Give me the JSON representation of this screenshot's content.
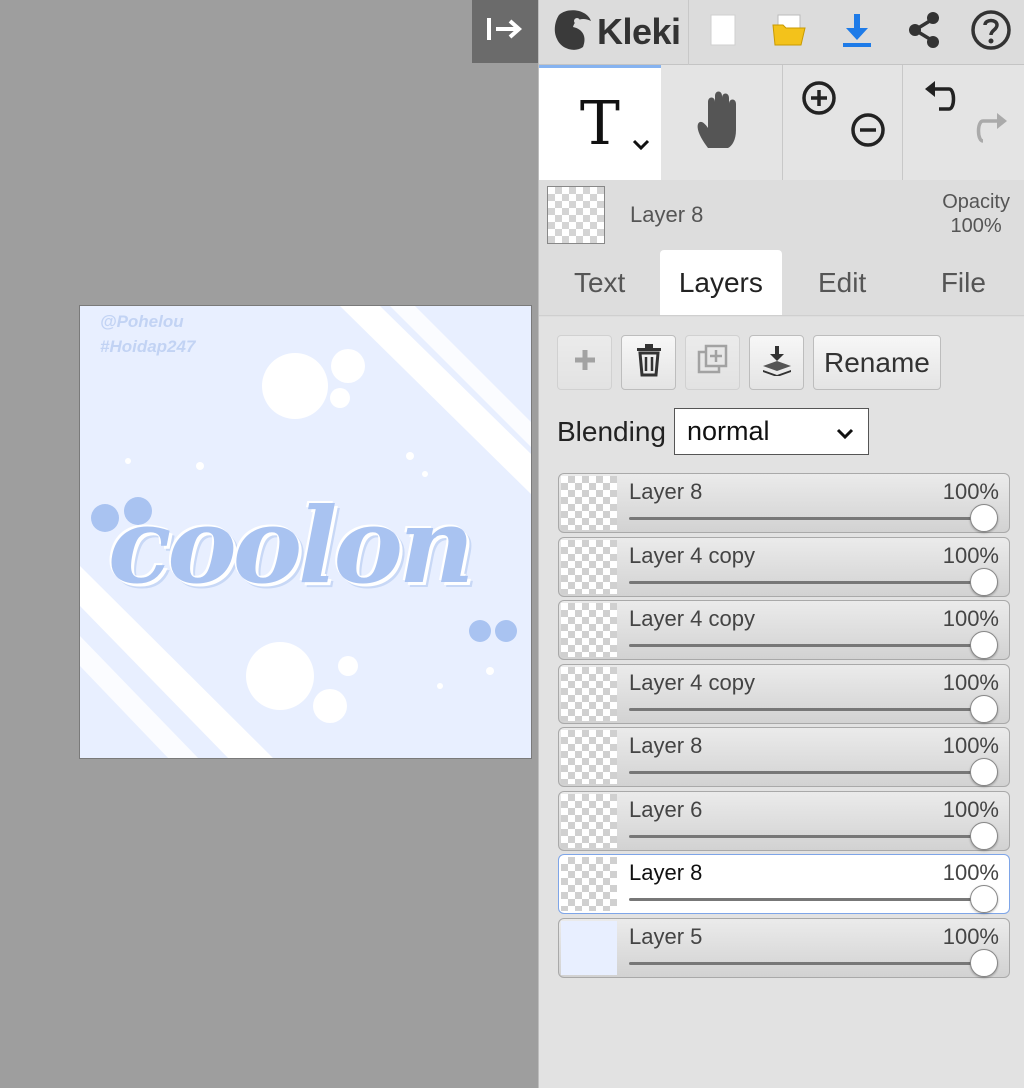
{
  "app": {
    "name": "Kleki"
  },
  "icons": {
    "collapse": "collapse-panel-icon",
    "logo": "kleki-logo-icon",
    "new": "new-file-icon",
    "open": "open-folder-icon",
    "save": "download-icon",
    "share": "share-icon",
    "help": "help-icon",
    "text_tool": "text-tool-icon",
    "hand_tool": "hand-tool-icon",
    "zoom_in": "zoom-in-icon",
    "zoom_out": "zoom-out-icon",
    "undo": "undo-icon",
    "redo": "redo-icon",
    "add_layer": "add-layer-icon",
    "delete_layer": "trash-icon",
    "duplicate_layer": "duplicate-layer-icon",
    "merge_layer": "merge-down-icon"
  },
  "colors": {
    "accent": "#86b3f0",
    "download": "#1e7be8",
    "folder": "#f3c21b",
    "art_bg": "#e8efff",
    "art_text": "#a9c3f1"
  },
  "toolbar": {
    "text_tool_glyph": "T"
  },
  "current_layer": {
    "name": "Layer 8",
    "opacity_label": "Opacity",
    "opacity_value": "100%"
  },
  "tabs": [
    {
      "label": "Text",
      "active": false
    },
    {
      "label": "Layers",
      "active": true
    },
    {
      "label": "Edit",
      "active": false
    },
    {
      "label": "File",
      "active": false
    }
  ],
  "layer_actions": {
    "rename_label": "Rename"
  },
  "blending": {
    "label": "Blending",
    "value": "normal"
  },
  "layers": [
    {
      "name": "Layer 8",
      "opacity": "100%",
      "opacity_value": 1.0,
      "selected": false
    },
    {
      "name": "Layer 4 copy",
      "opacity": "100%",
      "opacity_value": 1.0,
      "selected": false
    },
    {
      "name": "Layer 4 copy",
      "opacity": "100%",
      "opacity_value": 1.0,
      "selected": false
    },
    {
      "name": "Layer 4 copy",
      "opacity": "100%",
      "opacity_value": 1.0,
      "selected": false
    },
    {
      "name": "Layer 8",
      "opacity": "100%",
      "opacity_value": 1.0,
      "selected": false
    },
    {
      "name": "Layer 6",
      "opacity": "100%",
      "opacity_value": 1.0,
      "selected": false
    },
    {
      "name": "Layer 8",
      "opacity": "100%",
      "opacity_value": 1.0,
      "selected": true
    },
    {
      "name": "Layer 5",
      "opacity": "100%",
      "opacity_value": 1.0,
      "selected": false
    }
  ],
  "artwork": {
    "watermark_line1": "@Pohelou",
    "watermark_line2": "#Hoidap247",
    "word": "coolon"
  }
}
